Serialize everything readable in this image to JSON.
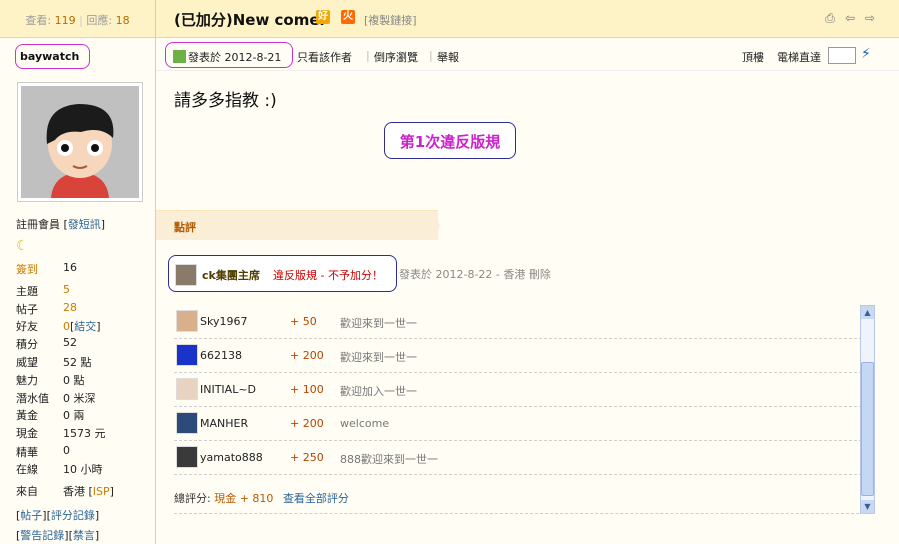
{
  "header": {
    "views_label": "查看:",
    "views": "119",
    "replies_label": "回應:",
    "replies": "18",
    "title": "(已加分)New comer",
    "badge_good": "好",
    "badge_hot": "火",
    "copy_link": "[複製鏈接]",
    "icons": [
      "printer-icon",
      "prev-icon",
      "next-icon"
    ]
  },
  "author": {
    "username": "baywatch",
    "group_label": "註冊會員",
    "send_message": "發短訊",
    "stats": [
      {
        "label": "簽到",
        "value": "16"
      },
      {
        "label": "主題",
        "value": "5"
      },
      {
        "label": "帖子",
        "value": "28"
      },
      {
        "label": "好友",
        "value": "0",
        "extra": "結交"
      },
      {
        "label": "積分",
        "value": "52"
      },
      {
        "label": "威望",
        "value": "52 點"
      },
      {
        "label": "魅力",
        "value": "0 點"
      },
      {
        "label": "潛水值",
        "value": "0 米深"
      },
      {
        "label": "黃金",
        "value": "0 兩"
      },
      {
        "label": "現金",
        "value": "1573 元"
      },
      {
        "label": "精華",
        "value": "0"
      },
      {
        "label": "在線",
        "value": "10 小時"
      },
      {
        "label": "來自",
        "value": "香港",
        "extra": "ISP"
      }
    ],
    "links_row1": [
      "帖子",
      "評分記錄"
    ],
    "links_row2": [
      "警告記錄",
      "禁言"
    ]
  },
  "post": {
    "posted_label": "發表於 2012-8-21",
    "only_author": "只看該作者",
    "reverse": "倒序瀏覽",
    "report": "舉報",
    "top": "頂樓",
    "elevator": "電梯直達",
    "content": "請多多指教 :)",
    "violation": "第1次違反版規"
  },
  "rating": {
    "tab_label": "點評",
    "moderator": "ck集團主席",
    "moderator_reason": "違反版規 - 不予加分！",
    "moderator_meta": "發表於 2012-8-22 - 香港 刪除",
    "rows": [
      {
        "user": "Sky1967",
        "points": "+ 50",
        "message": "歡迎來到一世一"
      },
      {
        "user": "662138",
        "points": "+ 200",
        "message": "歡迎來到一世一"
      },
      {
        "user": "INITIAL~D",
        "points": "+ 100",
        "message": "歡迎加入一世一"
      },
      {
        "user": "MANHER",
        "points": "+ 200",
        "message": "welcome"
      },
      {
        "user": "yamato888",
        "points": "+ 250",
        "message": "888歡迎來到一世一"
      }
    ],
    "total_label": "總評分:",
    "total_value": "現金 + 810",
    "view_all": "查看全部評分"
  }
}
